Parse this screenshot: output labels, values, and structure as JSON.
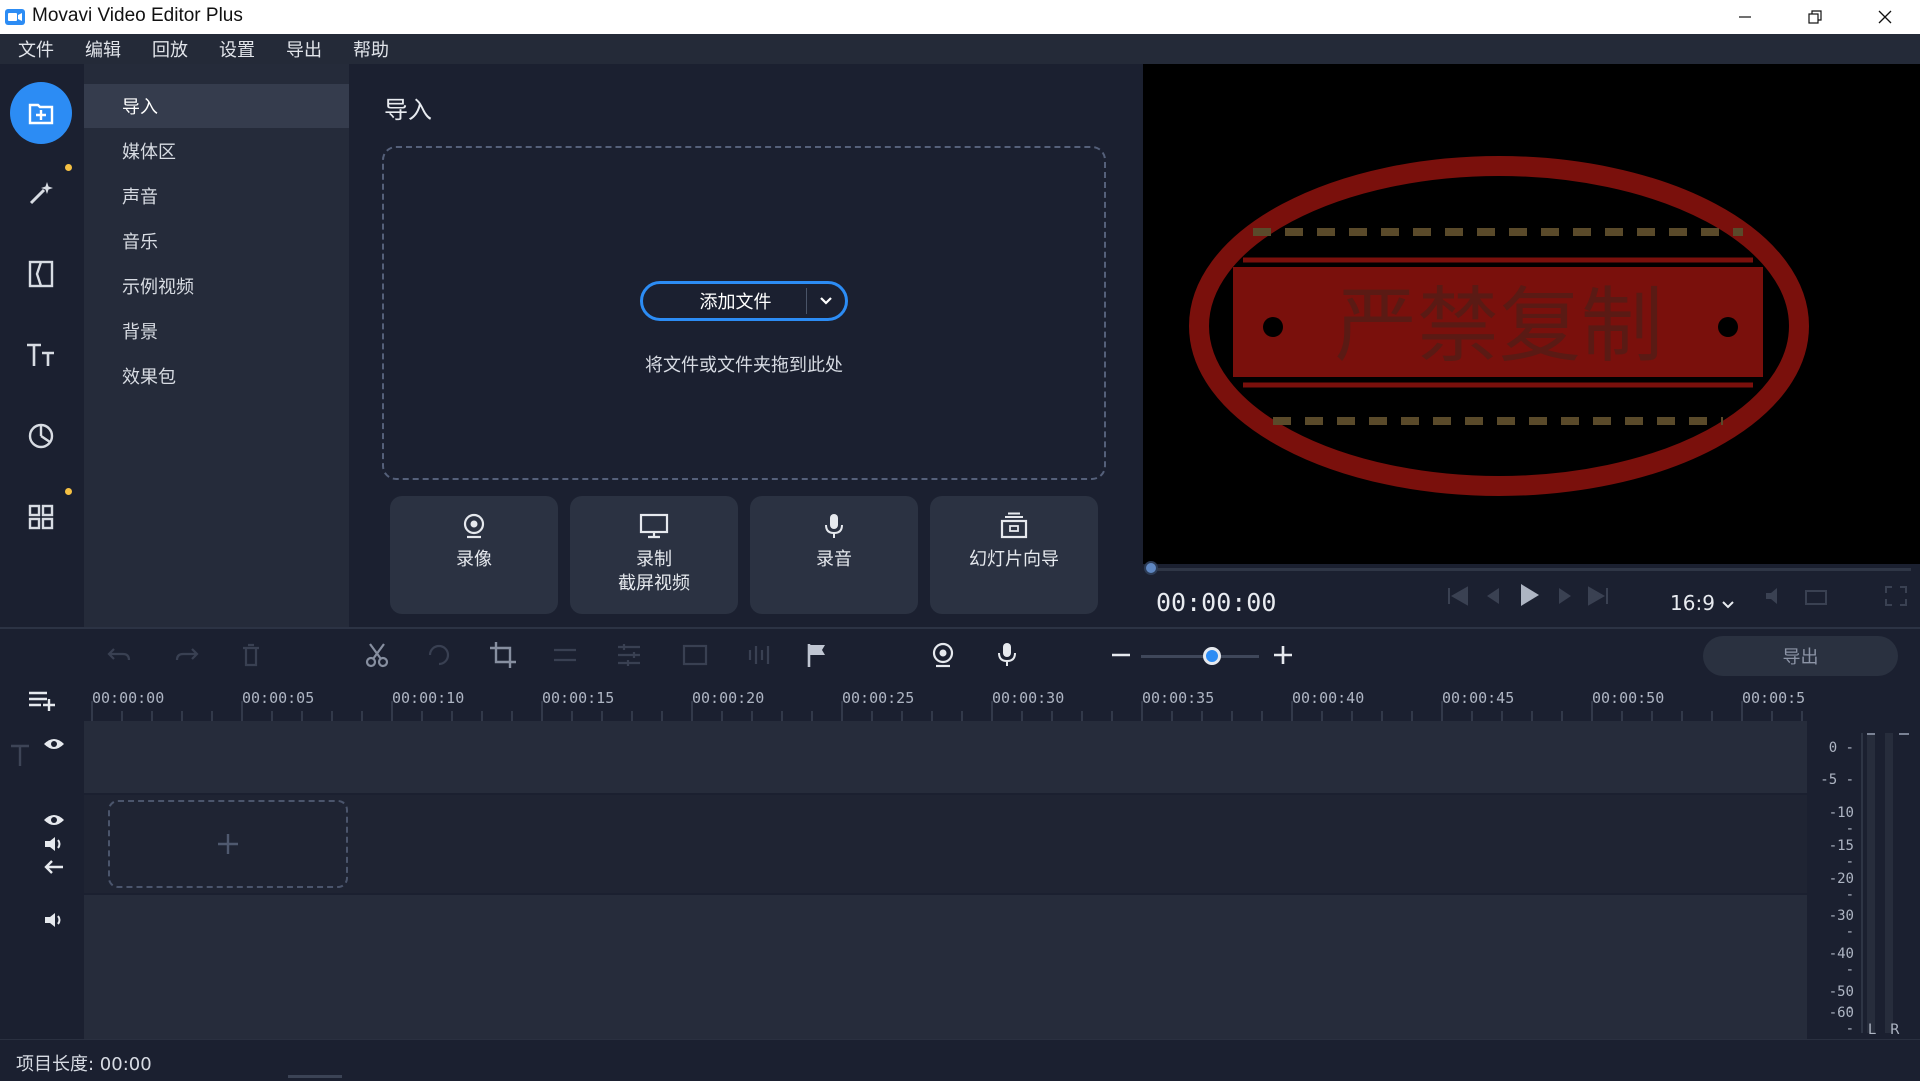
{
  "app": {
    "title": "Movavi Video Editor Plus"
  },
  "menu": {
    "items": [
      "文件",
      "编辑",
      "回放",
      "设置",
      "导出",
      "帮助"
    ]
  },
  "rail": {
    "icons": [
      "import-icon",
      "magic-wand-icon",
      "transitions-icon",
      "titles-icon",
      "stickers-icon",
      "more-tools-icon"
    ]
  },
  "categories": {
    "items": [
      "导入",
      "媒体区",
      "声音",
      "音乐",
      "示例视频",
      "背景",
      "效果包"
    ],
    "active_index": 0
  },
  "import": {
    "title": "导入",
    "add_files_label": "添加文件",
    "drop_hint": "将文件或文件夹拖到此处",
    "tiles": [
      {
        "label": "录像",
        "icon": "webcam-icon"
      },
      {
        "label": "录制\n截屏视频",
        "icon": "screen-record-icon"
      },
      {
        "label": "录音",
        "icon": "microphone-icon"
      },
      {
        "label": "幻灯片向导",
        "icon": "slideshow-icon"
      }
    ]
  },
  "preview": {
    "watermark_text": "严禁复制",
    "timecode": "00:00:00",
    "aspect_ratio": "16:9",
    "progress": 0
  },
  "toolbar": {
    "export_label": "导出",
    "zoom_level": 0.6
  },
  "timeline": {
    "ticks": [
      "00:00:00",
      "00:00:05",
      "00:00:10",
      "00:00:15",
      "00:00:20",
      "00:00:25",
      "00:00:30",
      "00:00:35",
      "00:00:40",
      "00:00:45",
      "00:00:50",
      "00:00:5"
    ]
  },
  "meter": {
    "db_labels": [
      "0",
      "-5",
      "-10",
      "-15",
      "-20",
      "-30",
      "-40",
      "-50",
      "-60"
    ],
    "channels": [
      "L",
      "R"
    ]
  },
  "status": {
    "project_length": "项目长度: 00:00"
  },
  "colors": {
    "accent": "#2c8cf4",
    "background": "#1b2030",
    "panel": "#252b3a",
    "watermark_red": "#7a100c"
  }
}
